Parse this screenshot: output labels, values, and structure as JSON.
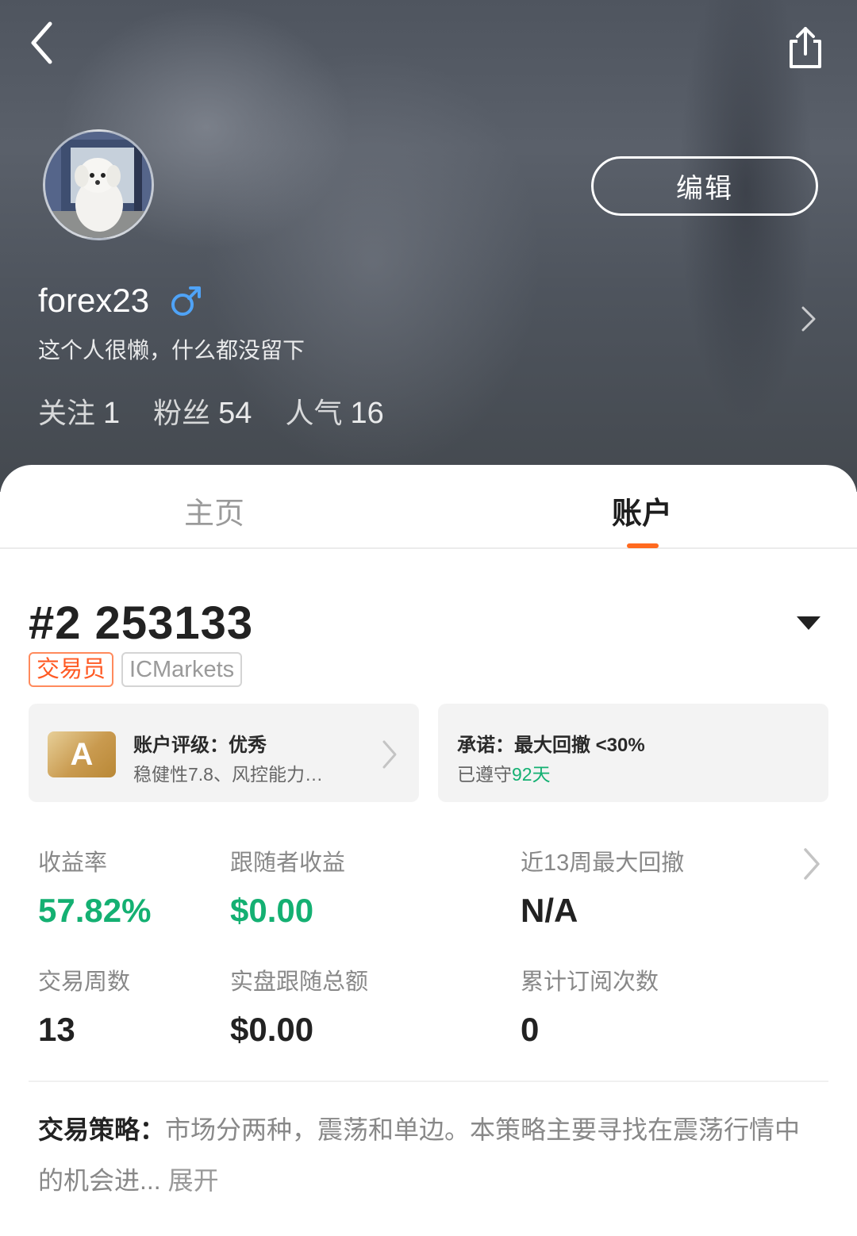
{
  "header": {
    "back_icon": "chevron-left-icon",
    "share_icon": "share-icon",
    "edit_label": "编辑"
  },
  "profile": {
    "username": "forex23",
    "gender_symbol": "♂",
    "bio": "这个人很懒，什么都没留下",
    "stats": [
      {
        "label": "关注",
        "value": "1"
      },
      {
        "label": "粉丝",
        "value": "54"
      },
      {
        "label": "人气",
        "value": "16"
      }
    ]
  },
  "tabs": [
    {
      "label": "主页",
      "active": false
    },
    {
      "label": "账户",
      "active": true
    }
  ],
  "account": {
    "number": "#2 253133",
    "badges": [
      "交易员",
      "ICMarkets"
    ],
    "rating": {
      "grade": "A",
      "title": "账户评级：优秀",
      "subtitle": "稳健性7.8、风控能力…"
    },
    "promise": {
      "title": "承诺：最大回撤 <30%",
      "subtitle_prefix": "已遵守",
      "days": "92天"
    },
    "metrics": [
      {
        "label": "收益率",
        "value": "57.82%"
      },
      {
        "label": "跟随者收益",
        "value": "$0.00"
      },
      {
        "label": "近13周最大回撤",
        "value": "N/A"
      },
      {
        "label": "交易周数",
        "value": "13"
      },
      {
        "label": "实盘跟随总额",
        "value": "$0.00"
      },
      {
        "label": "累计订阅次数",
        "value": "0"
      }
    ],
    "strategy": {
      "label": "交易策略：",
      "text": "市场分两种，震荡和单边。本策略主要寻找在震荡行情中的机会进...",
      "expand": "展开"
    }
  },
  "colors": {
    "accent": "#ff6a1f",
    "positive_green": "#14b072",
    "gender_blue": "#4fa3f7"
  }
}
